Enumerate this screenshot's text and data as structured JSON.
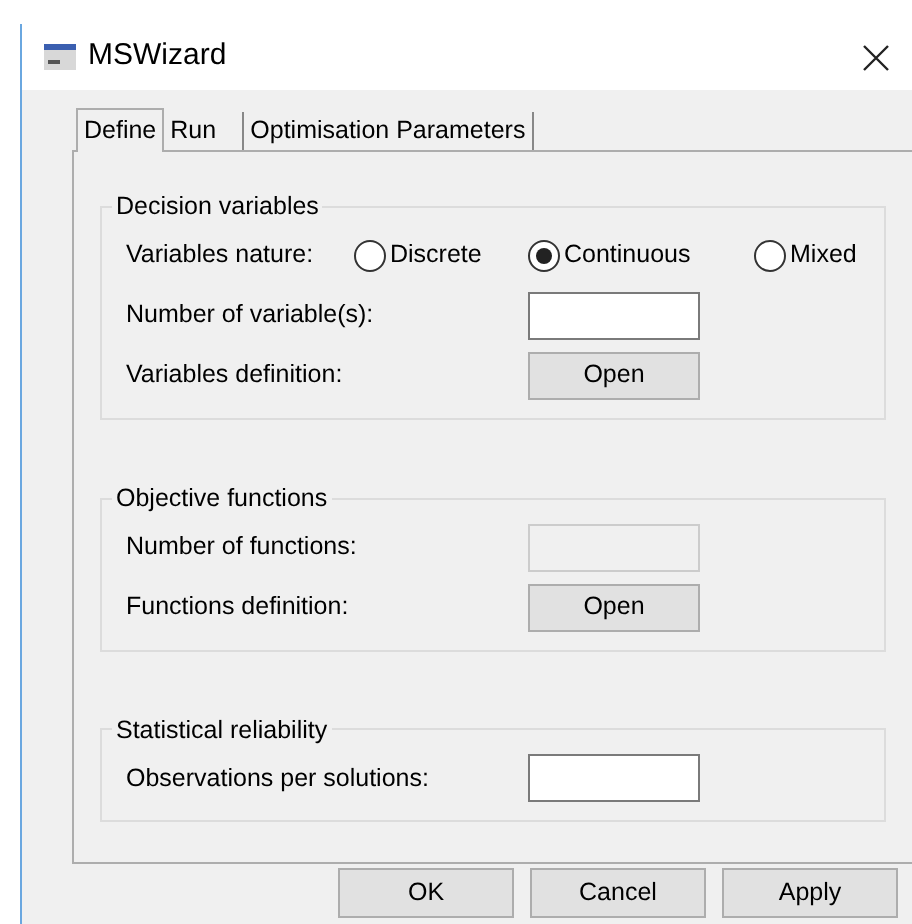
{
  "window": {
    "title": "MSWizard"
  },
  "tabs": [
    {
      "label": "Define",
      "selected": true
    },
    {
      "label": "Run",
      "selected": false
    },
    {
      "label": "Optimisation Parameters",
      "selected": false
    }
  ],
  "groups": [
    {
      "title": "Decision variables",
      "rows": [
        {
          "kind": "radio",
          "label": "Variables nature:",
          "options": [
            {
              "label": "Discrete",
              "selected": false
            },
            {
              "label": "Continuous",
              "selected": true
            },
            {
              "label": "Mixed",
              "selected": false
            }
          ]
        },
        {
          "kind": "field",
          "label": "Number of variable(s):",
          "disabled": false
        },
        {
          "kind": "button",
          "label": "Variables definition:",
          "button": "Open"
        }
      ]
    },
    {
      "title": "Objective functions",
      "rows": [
        {
          "kind": "field",
          "label": "Number of functions:",
          "disabled": true
        },
        {
          "kind": "button",
          "label": "Functions definition:",
          "button": "Open"
        }
      ]
    },
    {
      "title": "Statistical reliability",
      "rows": [
        {
          "kind": "field",
          "label": "Observations per solutions:",
          "disabled": false
        }
      ]
    }
  ],
  "buttons": [
    "OK",
    "Cancel",
    "Apply"
  ]
}
